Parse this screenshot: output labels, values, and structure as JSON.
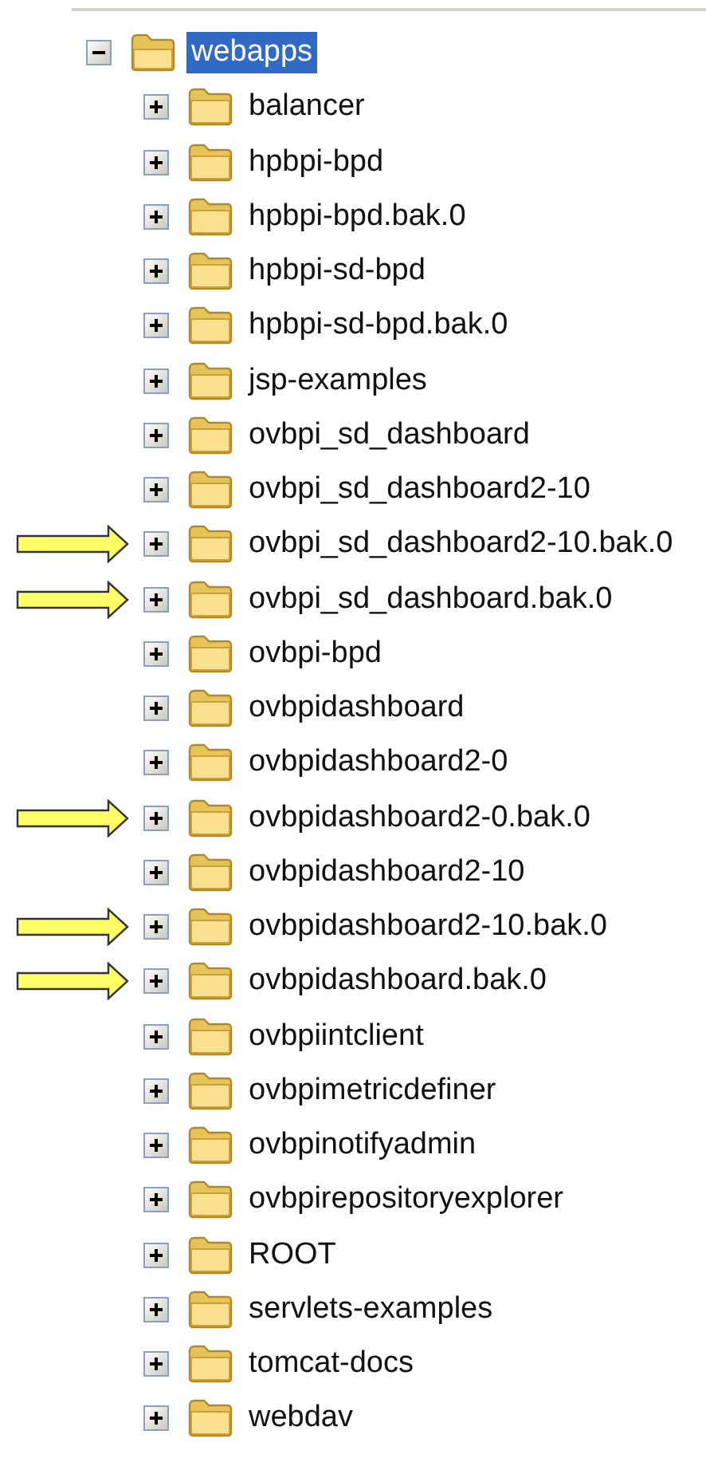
{
  "tree": {
    "label": "webapps",
    "expanded": true,
    "selected": true,
    "children": [
      {
        "label": "balancer",
        "expanded": false,
        "selected": false,
        "flagged": false
      },
      {
        "label": "hpbpi-bpd",
        "expanded": false,
        "selected": false,
        "flagged": false
      },
      {
        "label": "hpbpi-bpd.bak.0",
        "expanded": false,
        "selected": false,
        "flagged": false
      },
      {
        "label": "hpbpi-sd-bpd",
        "expanded": false,
        "selected": false,
        "flagged": false
      },
      {
        "label": "hpbpi-sd-bpd.bak.0",
        "expanded": false,
        "selected": false,
        "flagged": false
      },
      {
        "label": "jsp-examples",
        "expanded": false,
        "selected": false,
        "flagged": false
      },
      {
        "label": "ovbpi_sd_dashboard",
        "expanded": false,
        "selected": false,
        "flagged": false
      },
      {
        "label": "ovbpi_sd_dashboard2-10",
        "expanded": false,
        "selected": false,
        "flagged": false
      },
      {
        "label": "ovbpi_sd_dashboard2-10.bak.0",
        "expanded": false,
        "selected": false,
        "flagged": true
      },
      {
        "label": "ovbpi_sd_dashboard.bak.0",
        "expanded": false,
        "selected": false,
        "flagged": true
      },
      {
        "label": "ovbpi-bpd",
        "expanded": false,
        "selected": false,
        "flagged": false
      },
      {
        "label": "ovbpidashboard",
        "expanded": false,
        "selected": false,
        "flagged": false
      },
      {
        "label": "ovbpidashboard2-0",
        "expanded": false,
        "selected": false,
        "flagged": false
      },
      {
        "label": "ovbpidashboard2-0.bak.0",
        "expanded": false,
        "selected": false,
        "flagged": true
      },
      {
        "label": "ovbpidashboard2-10",
        "expanded": false,
        "selected": false,
        "flagged": false
      },
      {
        "label": "ovbpidashboard2-10.bak.0",
        "expanded": false,
        "selected": false,
        "flagged": true
      },
      {
        "label": "ovbpidashboard.bak.0",
        "expanded": false,
        "selected": false,
        "flagged": true
      },
      {
        "label": "ovbpiintclient",
        "expanded": false,
        "selected": false,
        "flagged": false
      },
      {
        "label": "ovbpimetricdefiner",
        "expanded": false,
        "selected": false,
        "flagged": false
      },
      {
        "label": "ovbpinotifyadmin",
        "expanded": false,
        "selected": false,
        "flagged": false
      },
      {
        "label": "ovbpirepositoryexplorer",
        "expanded": false,
        "selected": false,
        "flagged": false
      },
      {
        "label": "ROOT",
        "expanded": false,
        "selected": false,
        "flagged": false
      },
      {
        "label": "servlets-examples",
        "expanded": false,
        "selected": false,
        "flagged": false
      },
      {
        "label": "tomcat-docs",
        "expanded": false,
        "selected": false,
        "flagged": false
      },
      {
        "label": "webdav",
        "expanded": false,
        "selected": false,
        "flagged": false
      }
    ]
  }
}
